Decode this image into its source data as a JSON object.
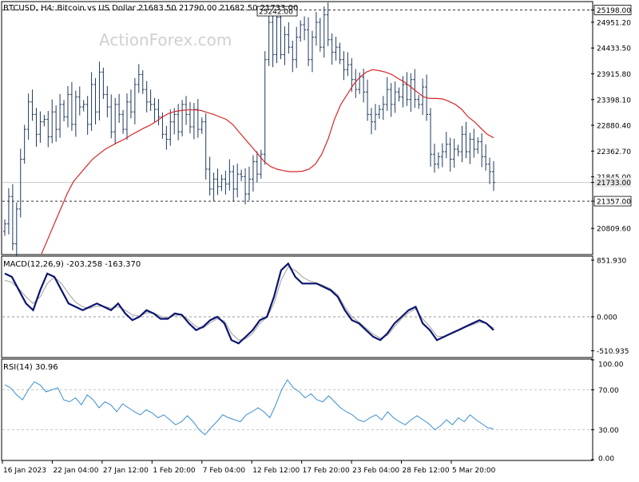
{
  "header": {
    "symbol_line": "BTCUSD, H4:  Bitcoin vs US Dollar  21683.50 21790.00 21682.50 21733.00",
    "watermark": "ActionForex.com"
  },
  "colors": {
    "candle": "#1f3a5f",
    "ma": "#d62728",
    "macd": "#0b1470",
    "signal": "#9e9e9e",
    "rsi": "#3a8ecf",
    "grid": "#c8c8c8",
    "price_marker_bg": "#e6e6e6"
  },
  "chart_data": [
    {
      "type": "line",
      "panel": "price",
      "title": "BTCUSD, H4:  Bitcoin vs US Dollar  21683.50 21790.00 21682.50 21733.00",
      "y_ticks": [
        "25198.00",
        "24951.20",
        "24433.50",
        "23915.80",
        "23398.10",
        "22880.40",
        "22362.70",
        "21845.00",
        "21733.00",
        "21357.00",
        "20809.60"
      ],
      "ylim": [
        20300,
        25350
      ],
      "annotations": {
        "high_label": "25242.00",
        "high_line": 25198.0,
        "low_line": 21357.0,
        "current": 21733.0
      },
      "series": [
        {
          "style": "candles",
          "values": [
            20900,
            21450,
            20500,
            21200,
            22200,
            22800,
            23350,
            23100,
            22700,
            22950,
            23000,
            22650,
            23150,
            22800,
            23300,
            23050,
            23500,
            22900,
            23450,
            23250,
            23300,
            22900,
            23700,
            23150,
            23950,
            23500,
            23250,
            22750,
            23300,
            23100,
            22800,
            23350,
            23150,
            23700,
            23900,
            23600,
            23350,
            23300,
            23200,
            23050,
            22700,
            22600,
            22950,
            23100,
            22750,
            23300,
            23100,
            22850,
            23200,
            22800,
            22950,
            22000,
            21600,
            21800,
            21650,
            21800,
            21700,
            21950,
            21600,
            21900,
            21850,
            21500,
            21800,
            22150,
            21900,
            22300,
            24200,
            24950,
            24300,
            25050,
            24300,
            24700,
            24450,
            24200,
            24650,
            24900,
            24800,
            24200,
            24650,
            24950,
            24450,
            25100,
            24600,
            24350,
            24450,
            24200,
            24000,
            24100,
            23800,
            23600,
            23850,
            23550,
            23100,
            22950,
            23100,
            23200,
            23300,
            23600,
            23300,
            23550,
            23450,
            23700,
            23400,
            23800,
            23400,
            23300,
            23650,
            23100,
            22300,
            22100,
            22250,
            22350,
            22500,
            22200,
            22400,
            22350,
            22700,
            22350,
            22600,
            22400,
            22550,
            22250,
            22100,
            21950,
            21733
          ]
        },
        {
          "style": "moving-average",
          "values": [
            20300,
            20600,
            20900,
            21200,
            21500,
            21750,
            21900,
            22050,
            22200,
            22300,
            22400,
            22470,
            22540,
            22600,
            22680,
            22750,
            22820,
            22880,
            22960,
            23050,
            23120,
            23160,
            23180,
            23190,
            23190,
            23180,
            23140,
            23100,
            23050,
            23000,
            22900,
            22750,
            22600,
            22450,
            22300,
            22150,
            22050,
            22000,
            21970,
            21950,
            21950,
            21960,
            22000,
            22100,
            22300,
            22600,
            23000,
            23300,
            23500,
            23700,
            23850,
            23950,
            24000,
            23980,
            23950,
            23900,
            23820,
            23750,
            23650,
            23550,
            23450,
            23420,
            23420,
            23410,
            23360,
            23300,
            23200,
            23050,
            22950,
            22820,
            22700,
            22630
          ]
        }
      ]
    },
    {
      "type": "line",
      "panel": "macd",
      "title": "MACD(12,26,9) -203.258 -163.370",
      "y_ticks": [
        "851.930",
        "0.000",
        "-510.935"
      ],
      "ylim": [
        -600,
        900
      ],
      "series": [
        {
          "style": "macd",
          "values": [
            650,
            600,
            400,
            200,
            100,
            400,
            650,
            600,
            400,
            200,
            150,
            100,
            150,
            200,
            150,
            100,
            200,
            50,
            -50,
            0,
            100,
            50,
            -30,
            -30,
            50,
            30,
            -100,
            -200,
            -150,
            -50,
            0,
            -100,
            -350,
            -400,
            -300,
            -200,
            -50,
            0,
            300,
            700,
            800,
            600,
            500,
            500,
            500,
            450,
            400,
            300,
            100,
            -50,
            -100,
            -200,
            -300,
            -350,
            -250,
            -100,
            0,
            100,
            150,
            -100,
            -200,
            -350,
            -300,
            -250,
            -200,
            -150,
            -100,
            -50,
            -100,
            -200
          ]
        },
        {
          "style": "signal",
          "values": [
            550,
            520,
            420,
            300,
            200,
            300,
            500,
            600,
            500,
            350,
            220,
            150,
            130,
            160,
            160,
            130,
            150,
            100,
            30,
            10,
            60,
            60,
            10,
            -20,
            20,
            30,
            -50,
            -150,
            -170,
            -90,
            -30,
            -60,
            -250,
            -350,
            -330,
            -250,
            -100,
            -10,
            200,
            550,
            750,
            700,
            600,
            540,
            510,
            470,
            420,
            330,
            150,
            0,
            -80,
            -170,
            -260,
            -320,
            -280,
            -150,
            -30,
            60,
            120,
            -30,
            -150,
            -290,
            -300,
            -260,
            -210,
            -160,
            -120,
            -80,
            -100,
            -170
          ]
        }
      ]
    },
    {
      "type": "line",
      "panel": "rsi",
      "title": "RSI(14) 30.96",
      "y_ticks": [
        "100.00",
        "70.00",
        "30.00",
        "0.00"
      ],
      "ylim": [
        0,
        100
      ],
      "levels": [
        70,
        30
      ],
      "series": [
        {
          "style": "rsi",
          "values": [
            75,
            72,
            65,
            60,
            70,
            78,
            75,
            68,
            70,
            72,
            60,
            58,
            62,
            55,
            65,
            60,
            52,
            58,
            55,
            48,
            56,
            52,
            48,
            45,
            50,
            47,
            42,
            45,
            40,
            35,
            38,
            44,
            38,
            30,
            25,
            32,
            38,
            45,
            42,
            40,
            38,
            45,
            48,
            52,
            48,
            42,
            55,
            70,
            80,
            72,
            68,
            62,
            66,
            60,
            58,
            64,
            58,
            52,
            48,
            45,
            40,
            38,
            42,
            45,
            40,
            48,
            42,
            38,
            35,
            40,
            44,
            40,
            36,
            30,
            34,
            40,
            35,
            42,
            38,
            45,
            40,
            36,
            32,
            31
          ]
        }
      ]
    }
  ],
  "x_axis": {
    "labels": [
      "16 Jan 2023",
      "22 Jan 04:00",
      "27 Jan 12:00",
      "1 Feb 20:00",
      "7 Feb 04:00",
      "12 Feb 12:00",
      "17 Feb 20:00",
      "23 Feb 04:00",
      "28 Feb 12:00",
      "5 Mar 20:00"
    ]
  }
}
